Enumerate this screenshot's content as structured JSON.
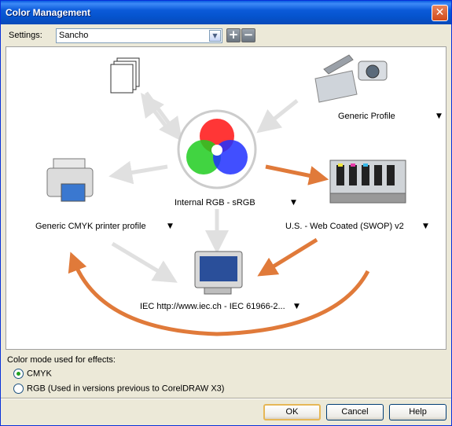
{
  "window": {
    "title": "Color Management"
  },
  "settings": {
    "label": "Settings:",
    "value": "Sancho"
  },
  "devices": {
    "internal": "Internal RGB - sRGB",
    "scanner": "Generic Profile",
    "printer": "Generic CMYK printer profile",
    "press": "U.S. - Web Coated (SWOP) v2",
    "monitor": "IEC http://www.iec.ch - IEC 61966-2..."
  },
  "effects": {
    "label": "Color mode used for effects:",
    "options": [
      "CMYK",
      "RGB (Used in versions previous to CorelDRAW X3)"
    ],
    "selected": "CMYK"
  },
  "buttons": {
    "ok": "OK",
    "cancel": "Cancel",
    "help": "Help"
  },
  "colors": {
    "accent_arrow": "#e07a3a",
    "ghost_arrow": "#e0e0e0",
    "title_bar": "#0553cc"
  },
  "icons": [
    "documents-icon",
    "scanner-camera-icon",
    "rgb-circles-icon",
    "printer-icon",
    "press-icon",
    "monitor-icon"
  ]
}
